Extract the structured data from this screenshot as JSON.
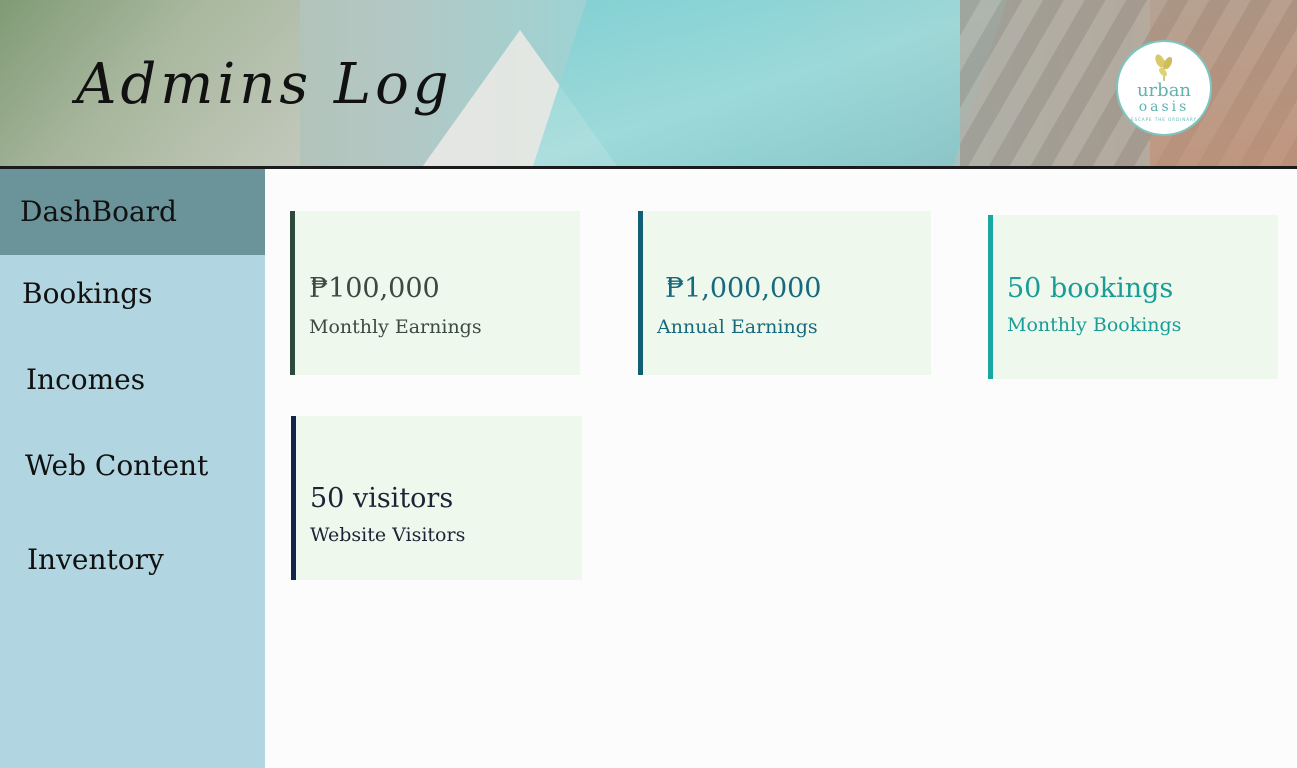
{
  "header": {
    "title": "Admins Log",
    "logo": {
      "line1": "urban",
      "line2": "oasis",
      "tagline": "ESCAPE THE ORDINARY"
    }
  },
  "sidebar": {
    "items": [
      {
        "label": "DashBoard",
        "active": true
      },
      {
        "label": "Bookings",
        "active": false
      },
      {
        "label": "Incomes",
        "active": false
      },
      {
        "label": "Web Content",
        "active": false
      },
      {
        "label": "Inventory",
        "active": false
      }
    ]
  },
  "cards": [
    {
      "value": "₱100,000",
      "label": "Monthly Earnings",
      "accent": "#2e4a3c",
      "text_color": "#3c4a44"
    },
    {
      "value": "₱1,000,000",
      "label": "Annual Earnings",
      "accent": "#105f74",
      "text_color": "#176a7e"
    },
    {
      "value": "50 bookings",
      "label": "Monthly Bookings",
      "accent": "#1aa7a2",
      "text_color": "#1a9c98"
    },
    {
      "value": "50 visitors",
      "label": "Website Visitors",
      "accent": "#12264a",
      "text_color": "#1a2436"
    }
  ],
  "colors": {
    "sidebar_bg": "#b2d6e1",
    "sidebar_active_bg": "#6a939a",
    "card_bg": "#eef8ec",
    "page_bg": "#fcfcfc"
  }
}
